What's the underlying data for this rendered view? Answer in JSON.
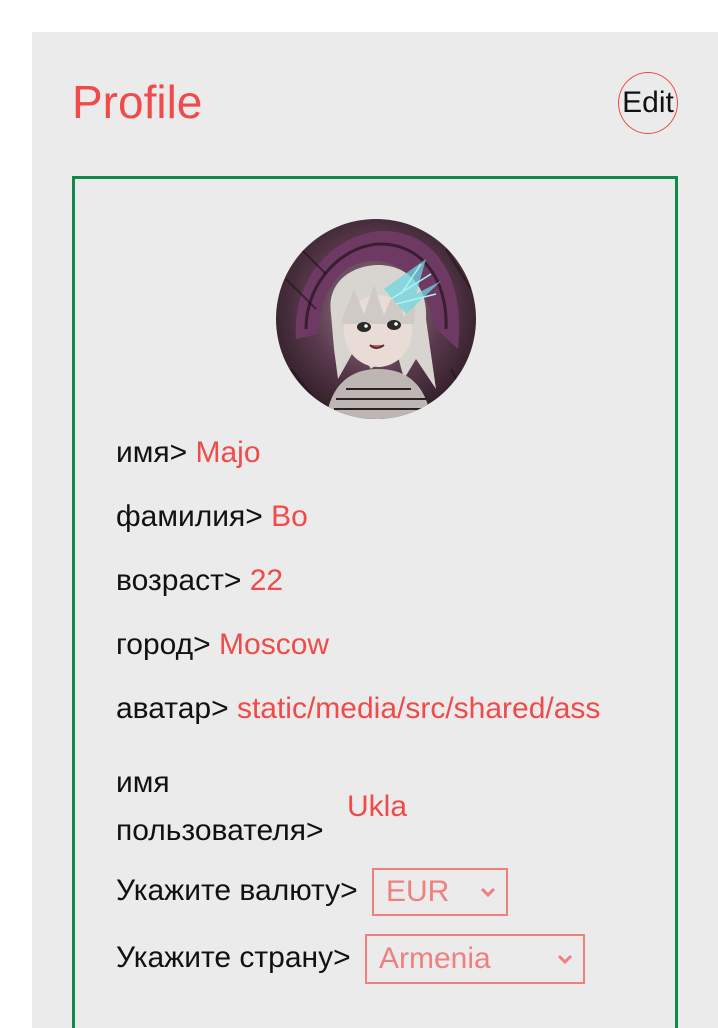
{
  "header": {
    "title": "Profile",
    "edit_label": "Edit"
  },
  "avatar": {
    "alt": "user avatar illustration"
  },
  "fields": [
    {
      "label": "имя>",
      "value": "Majo"
    },
    {
      "label": "фамилия>",
      "value": "Bo"
    },
    {
      "label": "возраст>",
      "value": "22"
    },
    {
      "label": "город>",
      "value": "Moscow"
    },
    {
      "label": "аватар>",
      "value": "static/media/src/shared/ass"
    }
  ],
  "username": {
    "label_line1": "имя",
    "label_line2": "пользователя>",
    "value": "Ukla"
  },
  "currency": {
    "label": "Укажите валюту>",
    "selected": "EUR"
  },
  "country": {
    "label": "Укажите страну>",
    "selected": "Armenia"
  },
  "colors": {
    "accent": "#f04a4a",
    "card_border": "#0f8a4a",
    "panel_bg": "#ebebeb"
  }
}
